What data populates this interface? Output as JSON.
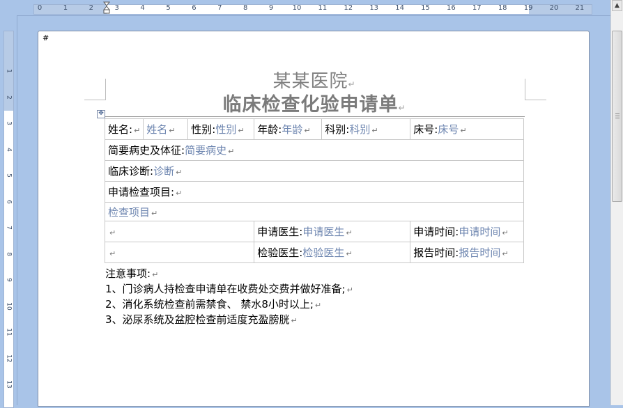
{
  "ruler": {
    "horizontal_labels": [
      "0",
      "1",
      "2",
      "3",
      "4",
      "5",
      "6",
      "7",
      "8",
      "9",
      "10",
      "11",
      "12",
      "13",
      "14",
      "15",
      "16",
      "17",
      "18",
      "19",
      "20",
      "21"
    ],
    "vertical_labels": [
      "1",
      "2",
      "3",
      "4",
      "5",
      "6",
      "7",
      "8",
      "9",
      "10",
      "11",
      "12",
      "13"
    ]
  },
  "document": {
    "anchor_mark": "#",
    "hospital_name": "某某医院",
    "form_title": "临床检查化验申请单",
    "paragraph_mark": "↵",
    "row1": {
      "name_label": "姓名:",
      "name_value": "姓名",
      "sex_label": "性别:",
      "sex_value": "性别",
      "age_label": "年龄:",
      "age_value": "年龄",
      "dept_label": "科别:",
      "dept_value": "科别",
      "bed_label": "床号:",
      "bed_value": "床号"
    },
    "history_label": "简要病史及体征:",
    "history_value": "简要病史",
    "diagnosis_label": "临床诊断:",
    "diagnosis_value": "诊断",
    "items_label": "申请检查项目:",
    "items_value": "检查项目",
    "row6": {
      "doctor_label": "申请医生:",
      "doctor_value": "申请医生",
      "time_label": "申请时间:",
      "time_value": "申请时间"
    },
    "row7": {
      "doctor_label": "检验医生:",
      "doctor_value": "检验医生",
      "time_label": "报告时间:",
      "time_value": "报告时间"
    },
    "notes": [
      "注意事项:",
      "1、门诊病人持检查申请单在收费处交费并做好准备;",
      "2、消化系统检查前需禁食、 禁水8小时以上;",
      "3、泌尿系统及盆腔检查前适度充盈膀胱"
    ]
  },
  "scrollbar": {
    "up_icon": "▲"
  }
}
